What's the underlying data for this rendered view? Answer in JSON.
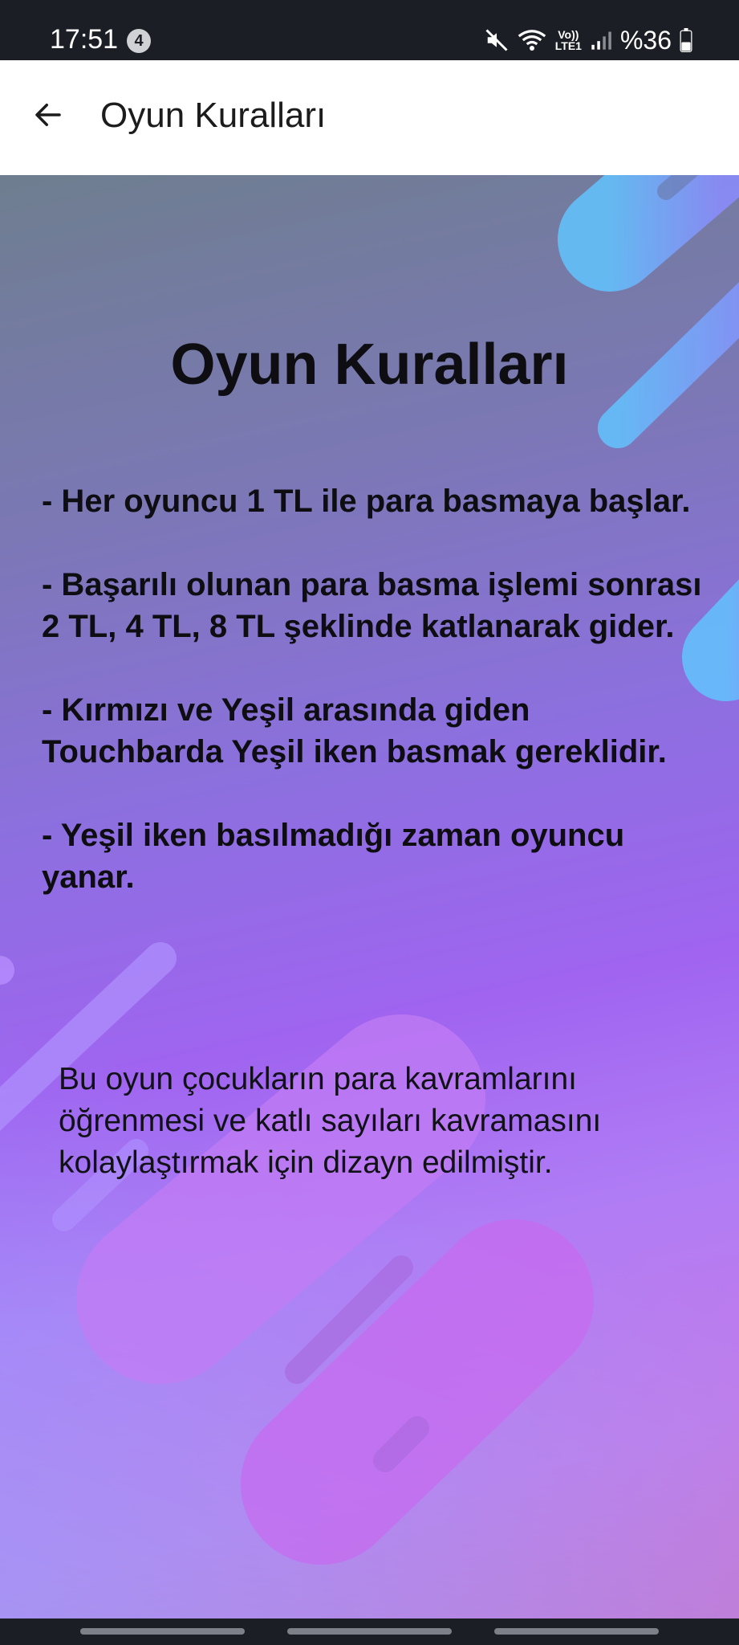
{
  "status_bar": {
    "time": "17:51",
    "notification_count": "4",
    "network_label": "Vo))\nLTE1",
    "battery": "%36",
    "icons": [
      "mute-icon",
      "wifi-icon",
      "lte-icon",
      "signal-icon",
      "battery-icon"
    ]
  },
  "app_bar": {
    "back_icon": "arrow-left-icon",
    "title": "Oyun Kuralları"
  },
  "content": {
    "heading": "Oyun Kuralları",
    "rules": [
      "- Her oyuncu 1 TL ile para basmaya başlar.",
      "- Başarılı olunan para basma işlemi sonrası 2 TL, 4 TL, 8 TL şeklinde katlanarak gider.",
      "- Kırmızı ve Yeşil arasında giden Touchbarda Yeşil iken basmak gereklidir.",
      "- Yeşil iken basılmadığı zaman oyuncu yanar."
    ],
    "about": "Bu oyun çocukların para kavramlarını öğrenmesi ve katlı sayıları kavramasını kolaylaştırmak için dizayn edilmiştir."
  },
  "colors": {
    "status_bar_bg": "#1b1e25",
    "app_bar_bg": "#ffffff",
    "gradient_top": "#6e7e8f",
    "gradient_mid": "#a064f0",
    "gradient_bottom": "#d46cc9",
    "accent_blue": "#6ec2ff",
    "accent_pink": "#d46af0"
  }
}
